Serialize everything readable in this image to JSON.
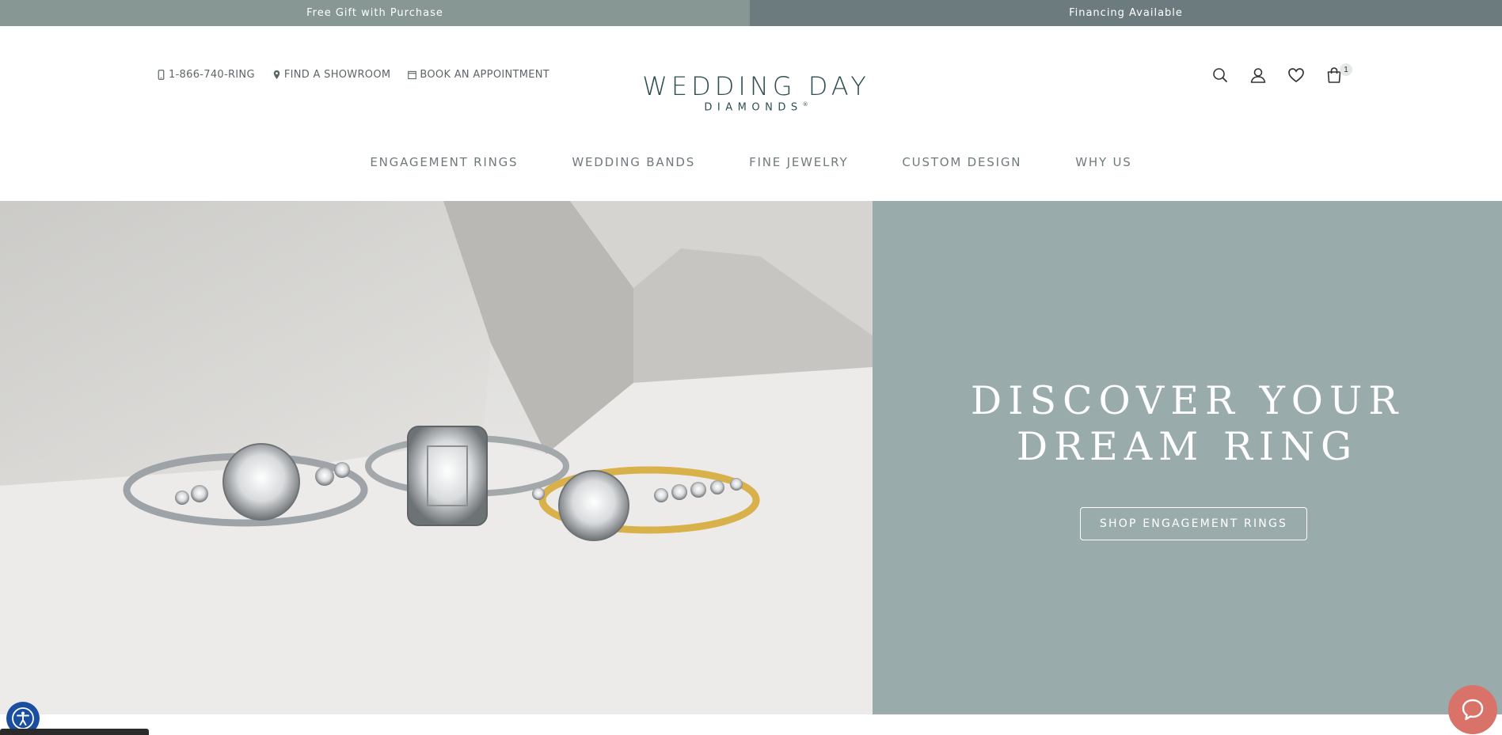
{
  "promo": {
    "left": "Free Gift with Purchase",
    "right": "Financing Available",
    "left_color": "#869794",
    "right_color": "#6c7c7e"
  },
  "utility": {
    "phone": "1-866-740-RING",
    "showroom": "FIND A SHOWROOM",
    "appointment": "BOOK AN APPOINTMENT"
  },
  "logo": {
    "line1": "WEDDING DAY",
    "line2": "DIAMONDS",
    "mark": "®",
    "color": "#2f4e51"
  },
  "header_icons": [
    "search-icon",
    "account-icon",
    "heart-icon",
    "shopping-bag-icon"
  ],
  "cart": {
    "count": "1"
  },
  "nav": {
    "items": [
      {
        "label": "ENGAGEMENT RINGS"
      },
      {
        "label": "WEDDING BANDS"
      },
      {
        "label": "FINE JEWELRY"
      },
      {
        "label": "CUSTOM DESIGN"
      },
      {
        "label": "WHY US"
      }
    ]
  },
  "hero": {
    "title_line1": "DISCOVER YOUR",
    "title_line2": "DREAM RING",
    "cta": "SHOP ENGAGEMENT RINGS",
    "panel_color": "#9aabab"
  },
  "widgets": {
    "accessibility": "accessibility-icon",
    "chat": "chat-icon",
    "chat_color": "#d9736a"
  }
}
